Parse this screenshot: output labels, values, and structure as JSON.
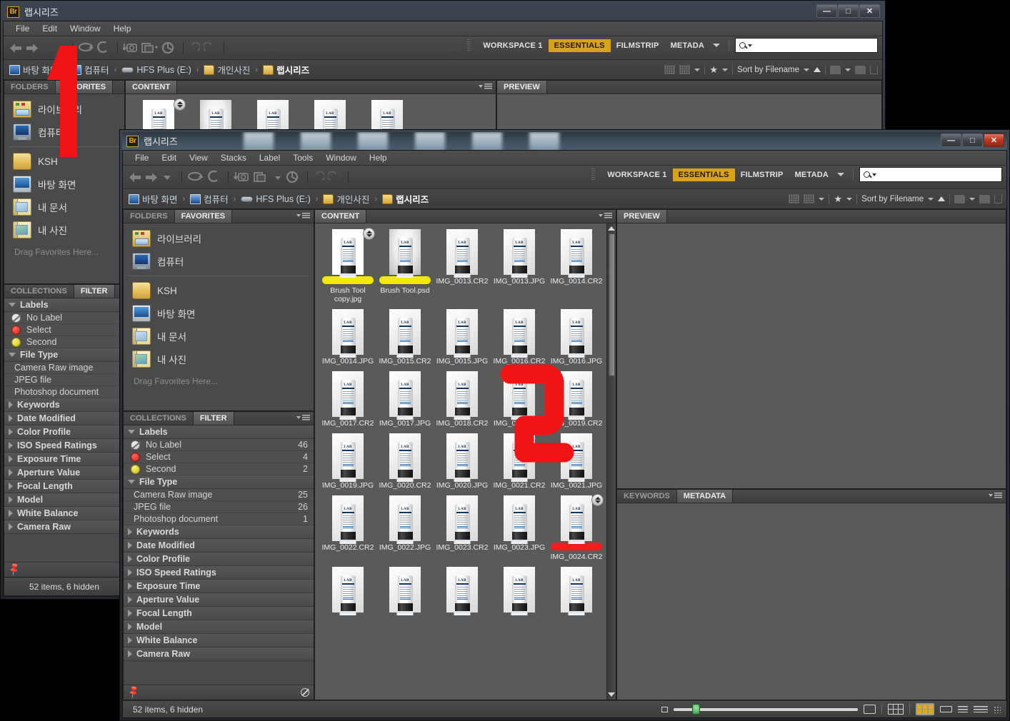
{
  "app": {
    "icon": "Br"
  },
  "back_window": {
    "title": "랩시리즈",
    "window_buttons": {
      "minimize": "—",
      "maximize": "□",
      "close": "✕"
    },
    "menus": [
      "File",
      "Edit",
      "Window",
      "Help"
    ],
    "breadcrumb": [
      {
        "label": "바탕 화면",
        "icon": "monitor-icon"
      },
      {
        "label": "컴퓨터",
        "icon": "computer-icon"
      },
      {
        "label": "HFS Plus (E:)",
        "icon": "drive-icon"
      },
      {
        "label": "개인사진",
        "icon": "folder-icon"
      },
      {
        "label": "랩시리즈",
        "icon": "folder-icon"
      }
    ],
    "workspaces": [
      "WORKSPACE 1",
      "ESSENTIALS",
      "FILMSTRIP",
      "METADA"
    ],
    "workspace_active": "ESSENTIALS",
    "search_placeholder": "",
    "sort_label": "Sort by Filename",
    "left_tabs": [
      "FAVORITES",
      "FOLDERS"
    ],
    "left_tab_active": "FAVORITES",
    "favorites": [
      {
        "label": "라이브러리",
        "icon": "library-icon"
      },
      {
        "label": "컴퓨터",
        "icon": "computer-icon"
      },
      {
        "label": "KSH",
        "icon": "folder-icon"
      },
      {
        "label": "바탕 화면",
        "icon": "desktop-icon"
      },
      {
        "label": "내 문서",
        "icon": "documents-icon"
      },
      {
        "label": "내 사진",
        "icon": "pictures-icon"
      }
    ],
    "favorites_hint": "Drag Favorites Here...",
    "filter_tabs": [
      "FILTER",
      "COLLECTIONS"
    ],
    "filter_tab_active": "FILTER",
    "filter_groups": [
      {
        "name": "Labels",
        "expanded": true,
        "rows": [
          {
            "label": "No Label",
            "count": "",
            "swatch": "none"
          },
          {
            "label": "Select",
            "count": "",
            "swatch": "red"
          },
          {
            "label": "Second",
            "count": "",
            "swatch": "yellow"
          }
        ]
      },
      {
        "name": "File Type",
        "expanded": true,
        "rows": [
          {
            "label": "Camera Raw image",
            "count": "",
            "swatch": ""
          },
          {
            "label": "JPEG file",
            "count": "",
            "swatch": ""
          },
          {
            "label": "Photoshop document",
            "count": "",
            "swatch": ""
          }
        ]
      },
      {
        "name": "Keywords",
        "expanded": false,
        "rows": []
      },
      {
        "name": "Date Modified",
        "expanded": false,
        "rows": []
      },
      {
        "name": "Color Profile",
        "expanded": false,
        "rows": []
      },
      {
        "name": "ISO Speed Ratings",
        "expanded": false,
        "rows": []
      },
      {
        "name": "Exposure Time",
        "expanded": false,
        "rows": []
      },
      {
        "name": "Aperture Value",
        "expanded": false,
        "rows": []
      },
      {
        "name": "Focal Length",
        "expanded": false,
        "rows": []
      },
      {
        "name": "Model",
        "expanded": false,
        "rows": []
      },
      {
        "name": "White Balance",
        "expanded": false,
        "rows": []
      },
      {
        "name": "Camera Raw",
        "expanded": false,
        "rows": []
      }
    ],
    "status": "52 items, 6 hidden",
    "content_tab": "CONTENT",
    "preview_tab": "PREVIEW"
  },
  "front_window": {
    "title": "랩시리즈",
    "window_buttons": {
      "minimize": "—",
      "maximize": "□",
      "close": "✕"
    },
    "menus": [
      "File",
      "Edit",
      "View",
      "Stacks",
      "Label",
      "Tools",
      "Window",
      "Help"
    ],
    "breadcrumb": [
      {
        "label": "바탕 화면",
        "icon": "monitor-icon"
      },
      {
        "label": "컴퓨터",
        "icon": "computer-icon"
      },
      {
        "label": "HFS Plus (E:)",
        "icon": "drive-icon"
      },
      {
        "label": "개인사진",
        "icon": "folder-icon"
      },
      {
        "label": "랩시리즈",
        "icon": "folder-icon"
      }
    ],
    "workspaces": [
      "WORKSPACE 1",
      "ESSENTIALS",
      "FILMSTRIP",
      "METADA"
    ],
    "workspace_active": "ESSENTIALS",
    "search_placeholder": "",
    "sort_label": "Sort by Filename",
    "left_tabs": [
      "FAVORITES",
      "FOLDERS"
    ],
    "left_tab_active": "FAVORITES",
    "favorites": [
      {
        "label": "라이브러리",
        "icon": "library-icon"
      },
      {
        "label": "컴퓨터",
        "icon": "computer-icon"
      },
      {
        "label": "KSH",
        "icon": "folder-icon"
      },
      {
        "label": "바탕 화면",
        "icon": "desktop-icon"
      },
      {
        "label": "내 문서",
        "icon": "documents-icon"
      },
      {
        "label": "내 사진",
        "icon": "pictures-icon"
      }
    ],
    "favorites_hint": "Drag Favorites Here...",
    "filter_tabs": [
      "FILTER",
      "COLLECTIONS"
    ],
    "filter_tab_active": "FILTER",
    "filter_groups": [
      {
        "name": "Labels",
        "expanded": true,
        "rows": [
          {
            "label": "No Label",
            "count": "46",
            "swatch": "none"
          },
          {
            "label": "Select",
            "count": "4",
            "swatch": "red"
          },
          {
            "label": "Second",
            "count": "2",
            "swatch": "yellow"
          }
        ]
      },
      {
        "name": "File Type",
        "expanded": true,
        "rows": [
          {
            "label": "Camera Raw image",
            "count": "25",
            "swatch": ""
          },
          {
            "label": "JPEG file",
            "count": "26",
            "swatch": ""
          },
          {
            "label": "Photoshop document",
            "count": "1",
            "swatch": ""
          }
        ]
      },
      {
        "name": "Keywords",
        "expanded": false,
        "rows": []
      },
      {
        "name": "Date Modified",
        "expanded": false,
        "rows": []
      },
      {
        "name": "Color Profile",
        "expanded": false,
        "rows": []
      },
      {
        "name": "ISO Speed Ratings",
        "expanded": false,
        "rows": []
      },
      {
        "name": "Exposure Time",
        "expanded": false,
        "rows": []
      },
      {
        "name": "Aperture Value",
        "expanded": false,
        "rows": []
      },
      {
        "name": "Focal Length",
        "expanded": false,
        "rows": []
      },
      {
        "name": "Model",
        "expanded": false,
        "rows": []
      },
      {
        "name": "White Balance",
        "expanded": false,
        "rows": []
      },
      {
        "name": "Camera Raw",
        "expanded": false,
        "rows": []
      }
    ],
    "status": "52 items, 6 hidden",
    "content_tab": "CONTENT",
    "preview_tab": "PREVIEW",
    "metadata_tabs": [
      "METADATA",
      "KEYWORDS"
    ],
    "metadata_tab_active": "METADATA",
    "thumbnails": [
      {
        "name": "Brush Tool copy.jpg",
        "label": "yellow",
        "style": "plain",
        "badge": "stack-icon"
      },
      {
        "name": "Brush Tool.psd",
        "label": "yellow",
        "style": "glow",
        "badge": ""
      },
      {
        "name": "IMG_0013.CR2",
        "label": "",
        "style": "",
        "badge": ""
      },
      {
        "name": "IMG_0013.JPG",
        "label": "",
        "style": "",
        "badge": ""
      },
      {
        "name": "IMG_0014.CR2",
        "label": "",
        "style": "",
        "badge": ""
      },
      {
        "name": "IMG_0014.JPG",
        "label": "",
        "style": "",
        "badge": ""
      },
      {
        "name": "IMG_0015.CR2",
        "label": "",
        "style": "",
        "badge": ""
      },
      {
        "name": "IMG_0015.JPG",
        "label": "",
        "style": "",
        "badge": ""
      },
      {
        "name": "IMG_0016.CR2",
        "label": "",
        "style": "",
        "badge": ""
      },
      {
        "name": "IMG_0016.JPG",
        "label": "",
        "style": "",
        "badge": ""
      },
      {
        "name": "IMG_0017.CR2",
        "label": "",
        "style": "",
        "badge": ""
      },
      {
        "name": "IMG_0017.JPG",
        "label": "",
        "style": "",
        "badge": ""
      },
      {
        "name": "IMG_0018.CR2",
        "label": "",
        "style": "",
        "badge": ""
      },
      {
        "name": "IMG_0018.JPG",
        "label": "",
        "style": "",
        "badge": ""
      },
      {
        "name": "IMG_0019.CR2",
        "label": "",
        "style": "",
        "badge": ""
      },
      {
        "name": "IMG_0019.JPG",
        "label": "",
        "style": "",
        "badge": ""
      },
      {
        "name": "IMG_0020.CR2",
        "label": "",
        "style": "",
        "badge": ""
      },
      {
        "name": "IMG_0020.JPG",
        "label": "",
        "style": "",
        "badge": ""
      },
      {
        "name": "IMG_0021.CR2",
        "label": "",
        "style": "",
        "badge": ""
      },
      {
        "name": "IMG_0021.JPG",
        "label": "",
        "style": "",
        "badge": ""
      },
      {
        "name": "IMG_0022.CR2",
        "label": "",
        "style": "",
        "badge": ""
      },
      {
        "name": "IMG_0022.JPG",
        "label": "",
        "style": "",
        "badge": ""
      },
      {
        "name": "IMG_0023.CR2",
        "label": "",
        "style": "",
        "badge": ""
      },
      {
        "name": "IMG_0023.JPG",
        "label": "",
        "style": "",
        "badge": ""
      },
      {
        "name": "IMG_0024.CR2",
        "label": "red",
        "style": "",
        "badge": "stack-icon"
      },
      {
        "name": "",
        "label": "",
        "style": "",
        "badge": ""
      },
      {
        "name": "",
        "label": "",
        "style": "",
        "badge": ""
      },
      {
        "name": "",
        "label": "",
        "style": "",
        "badge": ""
      },
      {
        "name": "",
        "label": "",
        "style": "",
        "badge": ""
      },
      {
        "name": "",
        "label": "",
        "style": "",
        "badge": ""
      }
    ]
  },
  "annotations": [
    {
      "text": "1",
      "color": "#f21414"
    },
    {
      "text": "2",
      "color": "#f21414"
    }
  ],
  "colors": {
    "accent": "#d9a21b",
    "label_yellow": "#f2ea00",
    "label_red": "#f21d1d",
    "annotation_red": "#f21414",
    "panel_bg": "#4a4a4a",
    "content_bg": "#5a5a5a"
  }
}
